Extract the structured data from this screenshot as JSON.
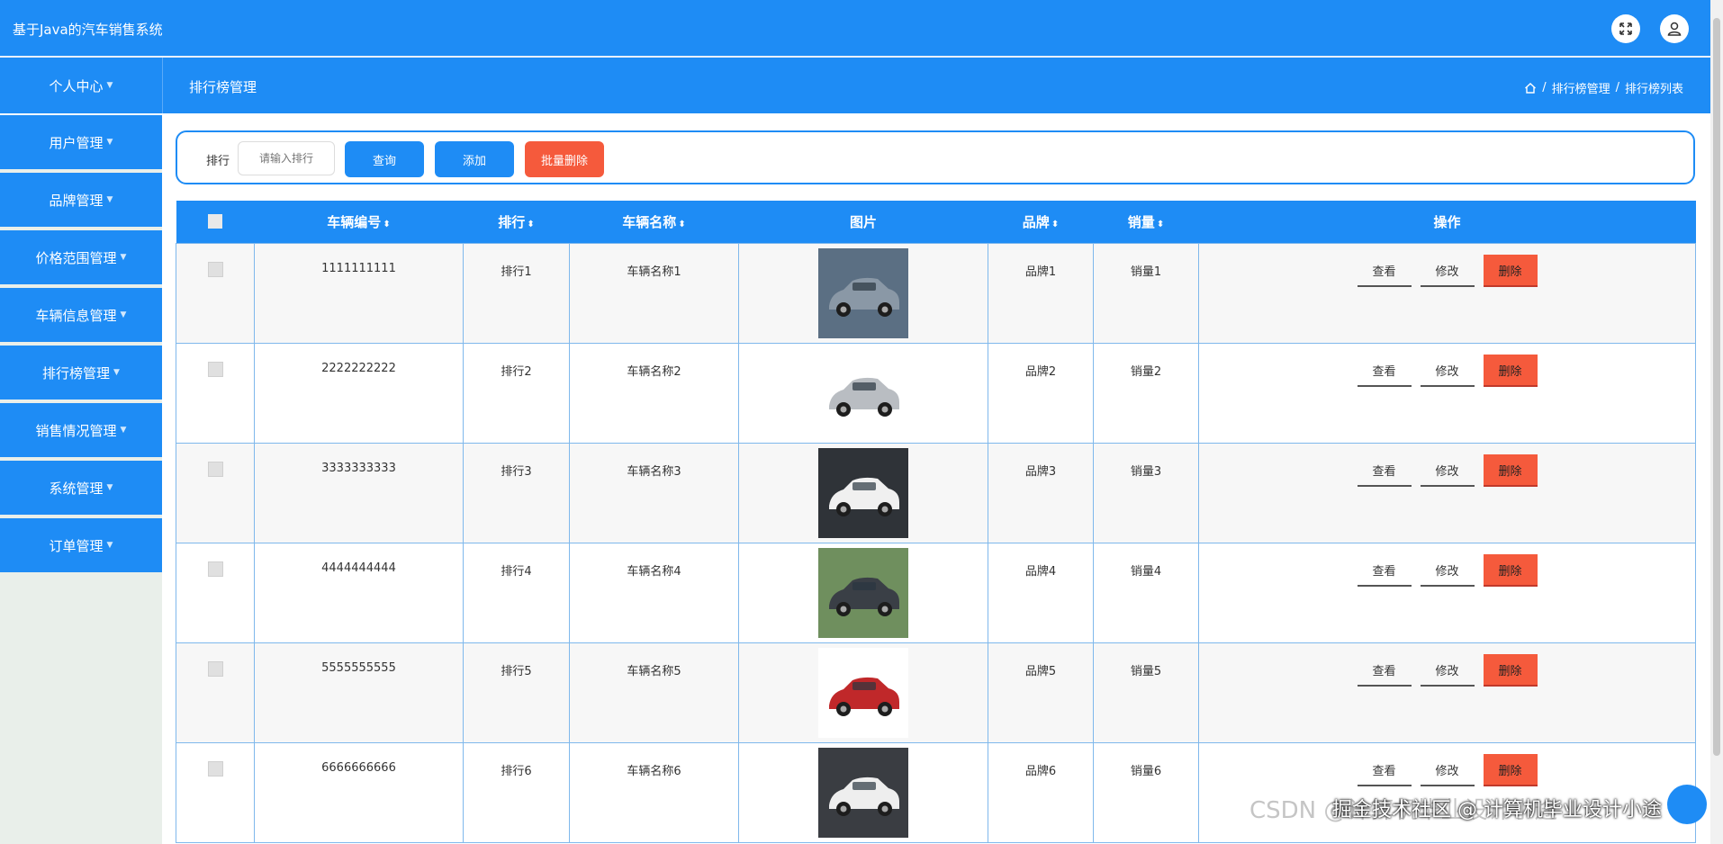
{
  "app": {
    "title": "基于Java的汽车销售系统"
  },
  "header": {
    "page_title": "排行榜管理",
    "breadcrumb": [
      "排行榜管理",
      "排行榜列表"
    ],
    "breadcrumb_sep": "/"
  },
  "sidebar": {
    "head": "个人中心",
    "items": [
      {
        "label": "用户管理"
      },
      {
        "label": "品牌管理"
      },
      {
        "label": "价格范围管理"
      },
      {
        "label": "车辆信息管理"
      },
      {
        "label": "排行榜管理"
      },
      {
        "label": "销售情况管理"
      },
      {
        "label": "系统管理"
      },
      {
        "label": "订单管理"
      }
    ]
  },
  "search": {
    "label": "排行",
    "placeholder": "请输入排行",
    "query_label": "查询",
    "add_label": "添加",
    "batch_delete_label": "批量删除"
  },
  "table": {
    "columns": [
      "车辆编号",
      "排行",
      "车辆名称",
      "图片",
      "品牌",
      "销量",
      "操作"
    ],
    "rows": [
      {
        "id": "1111111111",
        "rank": "排行1",
        "name": "车辆名称1",
        "brand": "品牌1",
        "sales": "销量1",
        "car_color": "#8a98a6"
      },
      {
        "id": "2222222222",
        "rank": "排行2",
        "name": "车辆名称2",
        "brand": "品牌2",
        "sales": "销量2",
        "car_color": "#b9bdc2"
      },
      {
        "id": "3333333333",
        "rank": "排行3",
        "name": "车辆名称3",
        "brand": "品牌3",
        "sales": "销量3",
        "car_color": "#f0f0f0"
      },
      {
        "id": "4444444444",
        "rank": "排行4",
        "name": "车辆名称4",
        "brand": "品牌4",
        "sales": "销量4",
        "car_color": "#3a3f46"
      },
      {
        "id": "5555555555",
        "rank": "排行5",
        "name": "车辆名称5",
        "brand": "品牌5",
        "sales": "销量5",
        "car_color": "#c0282a"
      },
      {
        "id": "6666666666",
        "rank": "排行6",
        "name": "车辆名称6",
        "brand": "品牌6",
        "sales": "销量6",
        "car_color": "#eeeeee"
      }
    ],
    "actions": {
      "view": "查看",
      "edit": "修改",
      "delete": "删除"
    }
  },
  "watermark": {
    "text": "CSDN @计算机毕业设计小途",
    "overlay": "掘金技术社区 @ 计算机毕业设计小途"
  },
  "colors": {
    "primary": "#1e8cf5",
    "danger": "#f55a3c"
  }
}
